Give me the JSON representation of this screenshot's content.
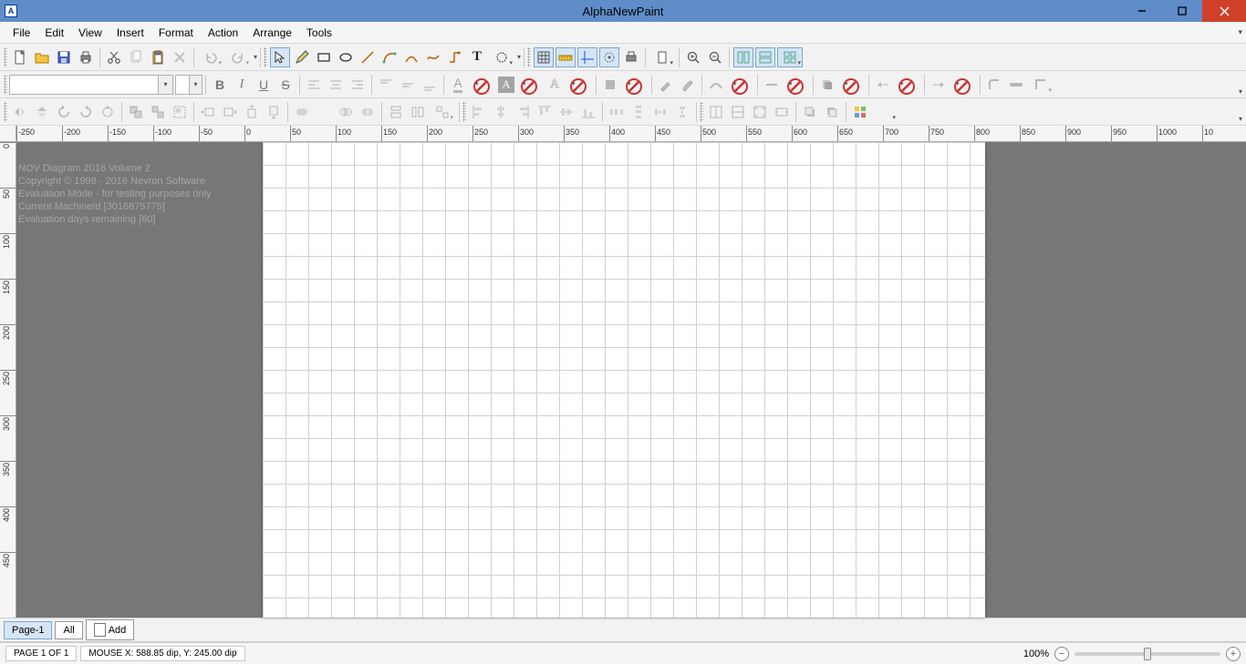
{
  "titlebar": {
    "title": "AlphaNewPaint",
    "icon_letter": "A"
  },
  "menubar": {
    "items": [
      "File",
      "Edit",
      "View",
      "Insert",
      "Format",
      "Action",
      "Arrange",
      "Tools"
    ]
  },
  "toolbar1": {
    "new": "new",
    "open": "open",
    "save": "save",
    "print": "print",
    "cut": "cut",
    "copy": "copy",
    "paste": "paste",
    "delete": "delete",
    "undo": "undo",
    "redo": "redo",
    "pointer": "pointer",
    "pencil": "pencil",
    "rect": "rectangle",
    "ellipse": "ellipse",
    "line": "line",
    "curve1": "bezier",
    "curve2": "arc",
    "curve3": "freehand",
    "connector": "connector",
    "text": "text",
    "pan": "pan",
    "grid": "grid",
    "ruler": "rulers",
    "guides": "guides",
    "snap": "snap",
    "print_pv": "print-preview",
    "page": "page-setup",
    "zoom_in": "zoom-in",
    "zoom_out": "zoom-out",
    "layout1": "layout1",
    "layout2": "layout2",
    "layout3": "layout3"
  },
  "toolbar2": {
    "font": "",
    "size": "",
    "bold": "B",
    "italic": "I",
    "underline": "U",
    "strike": "S",
    "align": [
      "left",
      "center",
      "right",
      "top",
      "middle",
      "bottom"
    ],
    "textfill": "A",
    "fill": "fill",
    "stroke": "stroke",
    "shadow": "shadow",
    "arrows": [
      "start",
      "end"
    ],
    "corner": "corner"
  },
  "toolbar3": {
    "flip": [
      "flip-h",
      "flip-v",
      "rotate-l",
      "rotate-r",
      "rotate-free"
    ],
    "group": [
      "group",
      "ungroup",
      "regroup"
    ],
    "nudge": [
      "left",
      "right",
      "up",
      "down"
    ],
    "shape_ops": [
      "union",
      "subtract",
      "intersect",
      "xor"
    ],
    "size_pos": [
      "same-width",
      "same-height",
      "same-size"
    ],
    "align2": [
      "left",
      "center",
      "right",
      "top",
      "middle",
      "bottom"
    ],
    "dist": [
      "dist-h",
      "dist-v",
      "space-h",
      "space-v"
    ],
    "order": [
      "front",
      "back",
      "forward",
      "backward"
    ],
    "extra": [
      "a",
      "b",
      "c"
    ]
  },
  "ruler": {
    "h_labels": [
      "-250",
      "-200",
      "-150",
      "-100",
      "-50",
      "0",
      "50",
      "100",
      "150",
      "200",
      "250",
      "300",
      "350",
      "400",
      "450",
      "500",
      "550",
      "600",
      "650",
      "700",
      "750",
      "800",
      "850",
      "900",
      "950",
      "1000",
      "10"
    ],
    "v_labels": [
      "0",
      "50",
      "100",
      "150",
      "200",
      "250",
      "300",
      "350",
      "400",
      "450"
    ]
  },
  "watermark": {
    "l1": "NOV Diagram 2016 Volume 2",
    "l2": "Copyright © 1998 - 2016 Nevron Software",
    "l3": "Evaluation Mode - for testing purposes only",
    "l4": "Current MachineId [3016875775]",
    "l5": "Evaluation days remaining [60]"
  },
  "page_tabs": {
    "page1": "Page-1",
    "all": "All",
    "add": "Add"
  },
  "statusbar": {
    "page": "PAGE 1 OF 1",
    "mouse": "MOUSE X: 588.85 dip, Y: 245.00 dip",
    "zoom_pct": "100%"
  }
}
